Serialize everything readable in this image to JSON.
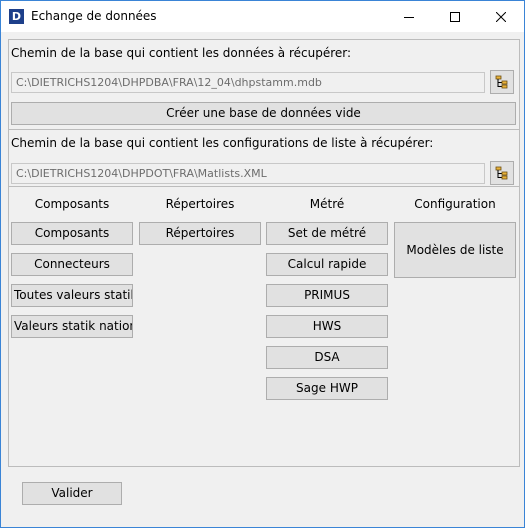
{
  "window": {
    "app_icon_letter": "D",
    "title": "Echange de données"
  },
  "database": {
    "label": "Chemin de la base qui contient les données à récupérer:",
    "path": "C:\\DIETRICHS1204\\DHPDBA\\FRA\\12_04\\dhpstamm.mdb",
    "create_empty_label": "Créer une base de données vide"
  },
  "config": {
    "label": "Chemin de la base qui contient les configurations de liste à récupérer:",
    "path": "C:\\DIETRICHS1204\\DHPDOT\\FRA\\Matlists.XML"
  },
  "columns": {
    "composants": {
      "header": "Composants",
      "buttons": [
        "Composants",
        "Connecteurs",
        "Toutes valeurs statik",
        "Valeurs statik nationa"
      ]
    },
    "repertoires": {
      "header": "Répertoires",
      "buttons": [
        "Répertoires"
      ]
    },
    "metre": {
      "header": "Métré",
      "buttons": [
        "Set de métré",
        "Calcul rapide",
        "PRIMUS",
        "HWS",
        "DSA",
        "Sage HWP"
      ]
    },
    "configuration": {
      "header": "Configuration",
      "buttons": [
        "Modèles de liste"
      ]
    }
  },
  "footer": {
    "validate_label": "Valider"
  },
  "icons": [
    "app-icon",
    "minimize-icon",
    "maximize-icon",
    "close-icon",
    "folder-tree-icon"
  ]
}
